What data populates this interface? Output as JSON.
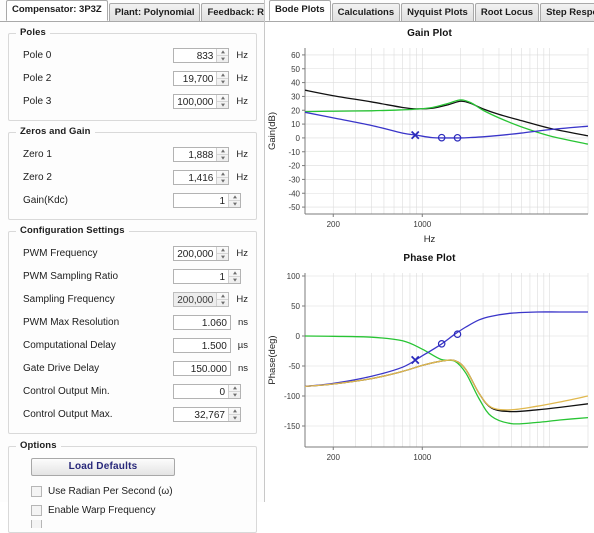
{
  "left_panel": {
    "tabs": [
      {
        "label": "Compensator: 3P3Z",
        "active": true
      },
      {
        "label": "Plant: Polynomial",
        "active": false
      },
      {
        "label": "Feedback: RC Netwo",
        "active": false
      }
    ],
    "groups": [
      {
        "title": "Poles",
        "rows": [
          {
            "label": "Pole 0",
            "value": "833",
            "unit": "Hz",
            "spinner": true,
            "disabled": false
          },
          {
            "label": "Pole 2",
            "value": "19,700",
            "unit": "Hz",
            "spinner": true,
            "disabled": false
          },
          {
            "label": "Pole 3",
            "value": "100,000",
            "unit": "Hz",
            "spinner": true,
            "disabled": false
          }
        ]
      },
      {
        "title": "Zeros and Gain",
        "rows": [
          {
            "label": "Zero 1",
            "value": "1,888",
            "unit": "Hz",
            "spinner": true,
            "disabled": false
          },
          {
            "label": "Zero 2",
            "value": "1,416",
            "unit": "Hz",
            "spinner": true,
            "disabled": false
          },
          {
            "label": "Gain(Kdc)",
            "value": "1",
            "unit": "",
            "spinner": true,
            "disabled": false
          }
        ]
      },
      {
        "title": "Configuration Settings",
        "rows": [
          {
            "label": "PWM Frequency",
            "value": "200,000",
            "unit": "Hz",
            "spinner": true,
            "disabled": false
          },
          {
            "label": "PWM Sampling Ratio",
            "value": "1",
            "unit": "",
            "spinner": true,
            "disabled": false
          },
          {
            "label": "Sampling Frequency",
            "value": "200,000",
            "unit": "Hz",
            "spinner": true,
            "disabled": true
          },
          {
            "label": "PWM Max Resolution",
            "value": "1.060",
            "unit": "ns",
            "spinner": false,
            "disabled": false
          },
          {
            "label": "Computational Delay",
            "value": "1.500",
            "unit": "µs",
            "spinner": false,
            "disabled": false
          },
          {
            "label": "Gate Drive Delay",
            "value": "150.000",
            "unit": "ns",
            "spinner": false,
            "disabled": false
          },
          {
            "label": "Control Output Min.",
            "value": "0",
            "unit": "",
            "spinner": true,
            "disabled": false
          },
          {
            "label": "Control Output Max.",
            "value": "32,767",
            "unit": "",
            "spinner": true,
            "disabled": false
          }
        ]
      }
    ],
    "options": {
      "title": "Options",
      "load_defaults_label": "Load Defaults",
      "checkboxes": [
        {
          "label": "Use Radian Per Second (ω)",
          "checked": false
        },
        {
          "label": "Enable Warp Frequency",
          "checked": false
        }
      ]
    }
  },
  "right_panel": {
    "tabs": [
      {
        "label": "Bode Plots",
        "active": true
      },
      {
        "label": "Calculations",
        "active": false
      },
      {
        "label": "Nyquist Plots",
        "active": false
      },
      {
        "label": "Root Locus",
        "active": false
      },
      {
        "label": "Step Response",
        "active": false
      }
    ]
  },
  "colors": {
    "curve_black": "#111111",
    "curve_green": "#28c434",
    "curve_blue": "#3a35c9",
    "curve_orange": "#e0b84e",
    "marker_blue": "#2b2bbb",
    "grid": "#dcdcdc",
    "axis": "#7b7b7b"
  },
  "chart_data": [
    {
      "type": "line",
      "title": "Gain Plot",
      "xlabel": "Hz",
      "ylabel": "Gain(dB)",
      "xscale": "log",
      "xlim": [
        120,
        20000
      ],
      "ylim": [
        -55,
        65
      ],
      "yticks": [
        60,
        50,
        40,
        30,
        20,
        10,
        0,
        -10,
        -20,
        -30,
        -40,
        -50
      ],
      "xticks": [
        200,
        1000
      ],
      "xticklabels": [
        "200",
        "1000"
      ],
      "grid": true,
      "legend": "none",
      "series": [
        {
          "name": "open-loop-gain",
          "color": "#111111",
          "x": [
            120,
            200,
            400,
            700,
            900,
            1200,
            1600,
            2000,
            2400,
            3000,
            4000,
            6000,
            10000,
            20000
          ],
          "y": [
            34.5,
            30.5,
            26.0,
            22.0,
            21.0,
            21.5,
            24.0,
            26.5,
            25.0,
            21.0,
            17.0,
            12.5,
            7.0,
            1.5
          ]
        },
        {
          "name": "plant-gain",
          "color": "#28c434",
          "x": [
            120,
            200,
            400,
            700,
            900,
            1200,
            1600,
            2000,
            2400,
            3000,
            4000,
            6000,
            10000,
            20000
          ],
          "y": [
            19.0,
            19.3,
            19.6,
            20.3,
            20.8,
            22.0,
            25.0,
            27.5,
            25.5,
            20.0,
            14.5,
            8.0,
            1.5,
            -4.5
          ]
        },
        {
          "name": "compensator-gain",
          "color": "#3a35c9",
          "x": [
            120,
            200,
            400,
            700,
            900,
            1200,
            1600,
            2000,
            2400,
            3000,
            4000,
            6000,
            10000,
            20000
          ],
          "y": [
            18.5,
            14.5,
            9.0,
            3.5,
            2.0,
            0.2,
            0.0,
            0.0,
            0.3,
            0.8,
            1.8,
            3.5,
            6.0,
            8.5
          ]
        }
      ],
      "markers": [
        {
          "shape": "x",
          "x": 880,
          "y": 2.0,
          "color": "#2b2bbb",
          "label": "pole-0-marker"
        },
        {
          "shape": "o",
          "x": 1420,
          "y": 0.2,
          "color": "#2b2bbb",
          "label": "zero-2-marker"
        },
        {
          "shape": "o",
          "x": 1890,
          "y": 0.1,
          "color": "#2b2bbb",
          "label": "zero-1-marker"
        }
      ]
    },
    {
      "type": "line",
      "title": "Phase Plot",
      "xlabel": "",
      "ylabel": "Phase(deg)",
      "xscale": "log",
      "xlim": [
        120,
        20000
      ],
      "ylim": [
        -185,
        105
      ],
      "yticks": [
        100,
        50,
        0,
        -50,
        -100,
        -150
      ],
      "xticks": [
        200,
        1000
      ],
      "xticklabels": [
        "200",
        "1000"
      ],
      "grid": true,
      "legend": "none",
      "series": [
        {
          "name": "open-loop-phase",
          "color": "#111111",
          "x": [
            120,
            200,
            400,
            700,
            1000,
            1400,
            1800,
            2200,
            2800,
            3500,
            5000,
            8000,
            12000,
            20000
          ],
          "y": [
            -84,
            -80,
            -71,
            -59,
            -49,
            -42,
            -41,
            -56,
            -96,
            -120,
            -126,
            -123,
            -119,
            -113
          ]
        },
        {
          "name": "plant-phase",
          "color": "#28c434",
          "x": [
            120,
            200,
            400,
            700,
            1000,
            1400,
            1800,
            2200,
            2800,
            3500,
            5000,
            8000,
            12000,
            20000
          ],
          "y": [
            0,
            -0.5,
            -2,
            -8,
            -22,
            -39,
            -42,
            -62,
            -105,
            -134,
            -146,
            -144,
            -140,
            -136
          ]
        },
        {
          "name": "compensator-phase",
          "color": "#3a35c9",
          "x": [
            120,
            200,
            400,
            700,
            1000,
            1400,
            1800,
            2200,
            2800,
            3500,
            5000,
            8000,
            12000,
            20000
          ],
          "y": [
            -84,
            -79,
            -67,
            -52,
            -33,
            -14,
            3,
            15,
            27,
            33,
            38,
            40,
            40,
            40
          ]
        },
        {
          "name": "loop-phase-alt",
          "color": "#e0b84e",
          "x": [
            120,
            200,
            400,
            700,
            1000,
            1400,
            1800,
            2200,
            2800,
            3500,
            5000,
            8000,
            12000,
            20000
          ],
          "y": [
            -84,
            -80,
            -71,
            -59,
            -49,
            -42,
            -41,
            -56,
            -96,
            -119,
            -123,
            -117,
            -110,
            -100
          ]
        }
      ],
      "markers": [
        {
          "shape": "x",
          "x": 880,
          "y": -40,
          "color": "#2b2bbb",
          "label": "pole-0-marker"
        },
        {
          "shape": "o",
          "x": 1420,
          "y": -13,
          "color": "#2b2bbb",
          "label": "zero-2-marker"
        },
        {
          "shape": "o",
          "x": 1890,
          "y": 3,
          "color": "#2b2bbb",
          "label": "zero-1-marker"
        }
      ]
    }
  ]
}
